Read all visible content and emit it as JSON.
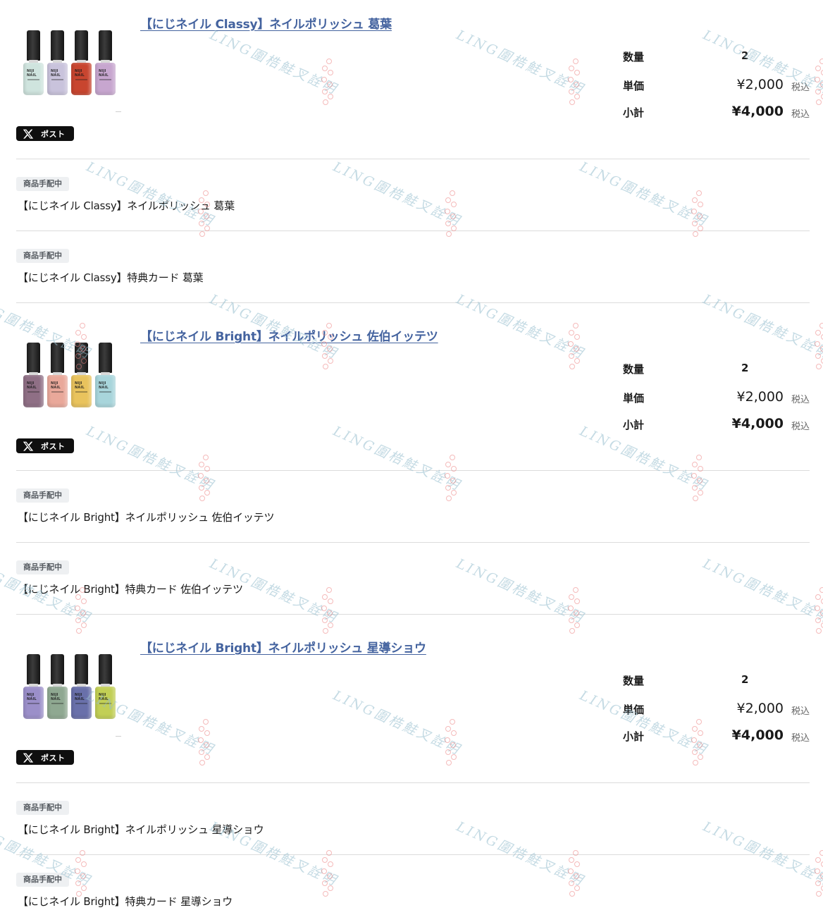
{
  "colors": {
    "link": "#44639f",
    "badge_bg": "#eef0f2",
    "post_button_bg": "#0f0f0f",
    "divider": "#dcdcdc"
  },
  "watermark": {
    "text": "LING圍梏鮭叉詮明"
  },
  "products": [
    {
      "title": "【にじネイル Classy】ネイルポリッシュ 葛葉",
      "image_label": "NIJI NAIL",
      "bottle_colors": [
        "#cfe4de",
        "#c9c3dc",
        "#c8452f",
        "#c7a6cf"
      ],
      "post_label": "ポスト",
      "post_icon": "x-logo-icon",
      "quantity_label": "数量",
      "quantity": "2",
      "unit_price_label": "単価",
      "unit_price": "¥2,000",
      "subtotal_label": "小計",
      "subtotal": "¥4,000",
      "tax_label": "税込",
      "items": [
        {
          "status": "商品手配中",
          "name": "【にじネイル Classy】ネイルポリッシュ 葛葉"
        },
        {
          "status": "商品手配中",
          "name": "【にじネイル Classy】特典カード 葛葉"
        }
      ]
    },
    {
      "title": "【にじネイル Bright】ネイルポリッシュ 佐伯イッテツ",
      "image_label": "NIJI NAIL",
      "bottle_colors": [
        "#8f6f85",
        "#e9a89a",
        "#e9c35d",
        "#a8d5db"
      ],
      "post_label": "ポスト",
      "post_icon": "x-logo-icon",
      "quantity_label": "数量",
      "quantity": "2",
      "unit_price_label": "単価",
      "unit_price": "¥2,000",
      "subtotal_label": "小計",
      "subtotal": "¥4,000",
      "tax_label": "税込",
      "items": [
        {
          "status": "商品手配中",
          "name": "【にじネイル Bright】ネイルポリッシュ 佐伯イッテツ"
        },
        {
          "status": "商品手配中",
          "name": "【にじネイル Bright】特典カード 佐伯イッテツ"
        }
      ]
    },
    {
      "title": "【にじネイル Bright】ネイルポリッシュ 星導ショウ",
      "image_label": "NIJI NAIL",
      "bottle_colors": [
        "#9b8fc9",
        "#8fa891",
        "#6970aa",
        "#c2cf55"
      ],
      "post_label": "ポスト",
      "post_icon": "x-logo-icon",
      "quantity_label": "数量",
      "quantity": "2",
      "unit_price_label": "単価",
      "unit_price": "¥2,000",
      "subtotal_label": "小計",
      "subtotal": "¥4,000",
      "tax_label": "税込",
      "items": [
        {
          "status": "商品手配中",
          "name": "【にじネイル Bright】ネイルポリッシュ 星導ショウ"
        },
        {
          "status": "商品手配中",
          "name": "【にじネイル Bright】特典カード 星導ショウ"
        }
      ]
    }
  ]
}
